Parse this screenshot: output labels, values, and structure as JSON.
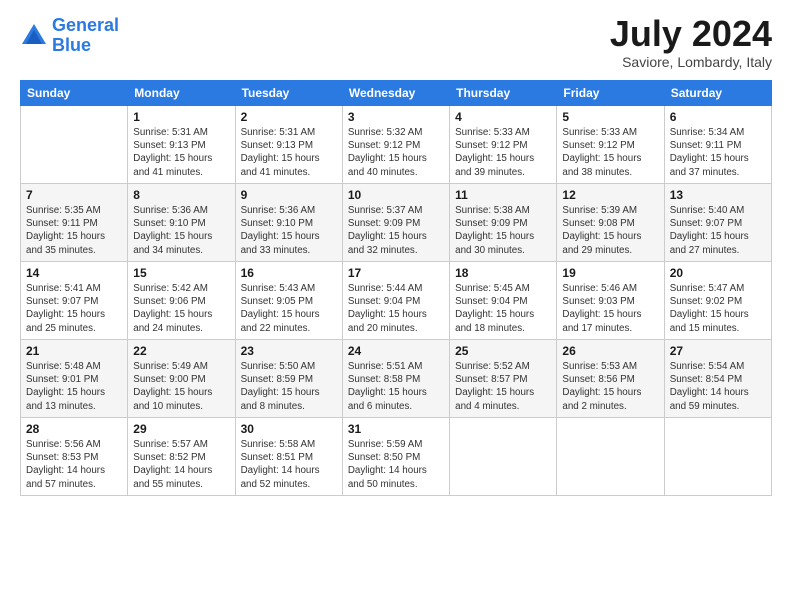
{
  "header": {
    "logo_line1": "General",
    "logo_line2": "Blue",
    "month": "July 2024",
    "location": "Saviore, Lombardy, Italy"
  },
  "days_of_week": [
    "Sunday",
    "Monday",
    "Tuesday",
    "Wednesday",
    "Thursday",
    "Friday",
    "Saturday"
  ],
  "weeks": [
    [
      {
        "day": "",
        "info": ""
      },
      {
        "day": "1",
        "info": "Sunrise: 5:31 AM\nSunset: 9:13 PM\nDaylight: 15 hours\nand 41 minutes."
      },
      {
        "day": "2",
        "info": "Sunrise: 5:31 AM\nSunset: 9:13 PM\nDaylight: 15 hours\nand 41 minutes."
      },
      {
        "day": "3",
        "info": "Sunrise: 5:32 AM\nSunset: 9:12 PM\nDaylight: 15 hours\nand 40 minutes."
      },
      {
        "day": "4",
        "info": "Sunrise: 5:33 AM\nSunset: 9:12 PM\nDaylight: 15 hours\nand 39 minutes."
      },
      {
        "day": "5",
        "info": "Sunrise: 5:33 AM\nSunset: 9:12 PM\nDaylight: 15 hours\nand 38 minutes."
      },
      {
        "day": "6",
        "info": "Sunrise: 5:34 AM\nSunset: 9:11 PM\nDaylight: 15 hours\nand 37 minutes."
      }
    ],
    [
      {
        "day": "7",
        "info": "Sunrise: 5:35 AM\nSunset: 9:11 PM\nDaylight: 15 hours\nand 35 minutes."
      },
      {
        "day": "8",
        "info": "Sunrise: 5:36 AM\nSunset: 9:10 PM\nDaylight: 15 hours\nand 34 minutes."
      },
      {
        "day": "9",
        "info": "Sunrise: 5:36 AM\nSunset: 9:10 PM\nDaylight: 15 hours\nand 33 minutes."
      },
      {
        "day": "10",
        "info": "Sunrise: 5:37 AM\nSunset: 9:09 PM\nDaylight: 15 hours\nand 32 minutes."
      },
      {
        "day": "11",
        "info": "Sunrise: 5:38 AM\nSunset: 9:09 PM\nDaylight: 15 hours\nand 30 minutes."
      },
      {
        "day": "12",
        "info": "Sunrise: 5:39 AM\nSunset: 9:08 PM\nDaylight: 15 hours\nand 29 minutes."
      },
      {
        "day": "13",
        "info": "Sunrise: 5:40 AM\nSunset: 9:07 PM\nDaylight: 15 hours\nand 27 minutes."
      }
    ],
    [
      {
        "day": "14",
        "info": "Sunrise: 5:41 AM\nSunset: 9:07 PM\nDaylight: 15 hours\nand 25 minutes."
      },
      {
        "day": "15",
        "info": "Sunrise: 5:42 AM\nSunset: 9:06 PM\nDaylight: 15 hours\nand 24 minutes."
      },
      {
        "day": "16",
        "info": "Sunrise: 5:43 AM\nSunset: 9:05 PM\nDaylight: 15 hours\nand 22 minutes."
      },
      {
        "day": "17",
        "info": "Sunrise: 5:44 AM\nSunset: 9:04 PM\nDaylight: 15 hours\nand 20 minutes."
      },
      {
        "day": "18",
        "info": "Sunrise: 5:45 AM\nSunset: 9:04 PM\nDaylight: 15 hours\nand 18 minutes."
      },
      {
        "day": "19",
        "info": "Sunrise: 5:46 AM\nSunset: 9:03 PM\nDaylight: 15 hours\nand 17 minutes."
      },
      {
        "day": "20",
        "info": "Sunrise: 5:47 AM\nSunset: 9:02 PM\nDaylight: 15 hours\nand 15 minutes."
      }
    ],
    [
      {
        "day": "21",
        "info": "Sunrise: 5:48 AM\nSunset: 9:01 PM\nDaylight: 15 hours\nand 13 minutes."
      },
      {
        "day": "22",
        "info": "Sunrise: 5:49 AM\nSunset: 9:00 PM\nDaylight: 15 hours\nand 10 minutes."
      },
      {
        "day": "23",
        "info": "Sunrise: 5:50 AM\nSunset: 8:59 PM\nDaylight: 15 hours\nand 8 minutes."
      },
      {
        "day": "24",
        "info": "Sunrise: 5:51 AM\nSunset: 8:58 PM\nDaylight: 15 hours\nand 6 minutes."
      },
      {
        "day": "25",
        "info": "Sunrise: 5:52 AM\nSunset: 8:57 PM\nDaylight: 15 hours\nand 4 minutes."
      },
      {
        "day": "26",
        "info": "Sunrise: 5:53 AM\nSunset: 8:56 PM\nDaylight: 15 hours\nand 2 minutes."
      },
      {
        "day": "27",
        "info": "Sunrise: 5:54 AM\nSunset: 8:54 PM\nDaylight: 14 hours\nand 59 minutes."
      }
    ],
    [
      {
        "day": "28",
        "info": "Sunrise: 5:56 AM\nSunset: 8:53 PM\nDaylight: 14 hours\nand 57 minutes."
      },
      {
        "day": "29",
        "info": "Sunrise: 5:57 AM\nSunset: 8:52 PM\nDaylight: 14 hours\nand 55 minutes."
      },
      {
        "day": "30",
        "info": "Sunrise: 5:58 AM\nSunset: 8:51 PM\nDaylight: 14 hours\nand 52 minutes."
      },
      {
        "day": "31",
        "info": "Sunrise: 5:59 AM\nSunset: 8:50 PM\nDaylight: 14 hours\nand 50 minutes."
      },
      {
        "day": "",
        "info": ""
      },
      {
        "day": "",
        "info": ""
      },
      {
        "day": "",
        "info": ""
      }
    ]
  ]
}
